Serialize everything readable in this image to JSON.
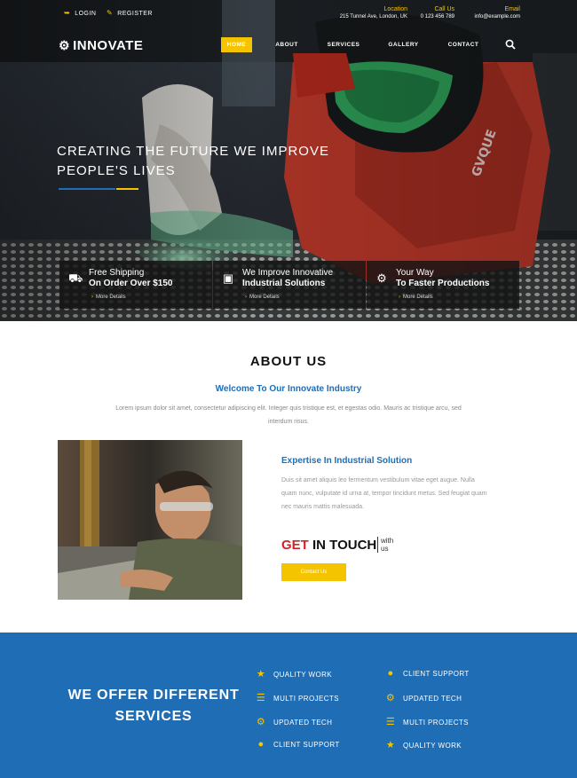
{
  "topbar": {
    "login": "LOGIN",
    "register": "REGISTER",
    "location_label": "Location",
    "location_value": "215 Tunnel Ave, London, UK",
    "call_label": "Call Us",
    "call_value": "0 123 456 789",
    "email_label": "Email",
    "email_value": "info@example.com"
  },
  "nav": {
    "logo": "INNOVATE",
    "items": [
      "HOME",
      "ABOUT",
      "SERVICES",
      "GALLERY",
      "CONTACT"
    ]
  },
  "hero": {
    "title_line1": "CREATING THE FUTURE WE IMPROVE",
    "title_line2": "PEOPLE'S LIVES"
  },
  "features": [
    {
      "line1": "Free Shipping",
      "line2": "On Order Over $150",
      "more": "More Details",
      "icon": "truck-icon"
    },
    {
      "line1": "We Improve Innovative",
      "line2": "Industrial Solutions",
      "more": "More Details",
      "icon": "factory-icon"
    },
    {
      "line1": "Your Way",
      "line2": "To Faster Productions",
      "more": "More Details",
      "icon": "gears-icon"
    }
  ],
  "about": {
    "title": "ABOUT US",
    "subtitle": "Welcome To Our Innovate Industry",
    "text": "Lorem ipsum dolor sit amet, consectetur adipiscing elit. Integer quis tristique est, et egestas odio. Mauris ac tristique arcu, sed interdum risus.",
    "expertise_title": "Expertise In Industrial Solution",
    "expertise_text": "Duis sit amet aliquis leo fermentum vestibulum vitae eget augue. Nulla quam nunc, vulputate id urna at, tempor tincidunt metus. Sed feugiat quam nec mauris mattis malesuada.",
    "get": "GET",
    "in_touch": " IN TOUCH",
    "with": "with",
    "us": "us",
    "button": "Contact Us"
  },
  "services": {
    "title_line1": "WE OFFER DIFFERENT",
    "title_line2": "SERVICES",
    "items": [
      {
        "label": "QUALITY WORK",
        "icon": "star-icon"
      },
      {
        "label": "CLIENT SUPPORT",
        "icon": "users-icon"
      },
      {
        "label": "MULTI PROJECTS",
        "icon": "server-icon"
      },
      {
        "label": "UPDATED TECH",
        "icon": "cogs-icon"
      },
      {
        "label": "UPDATED TECH",
        "icon": "cogs-icon"
      },
      {
        "label": "MULTI PROJECTS",
        "icon": "server-icon"
      },
      {
        "label": "CLIENT SUPPORT",
        "icon": "users-icon"
      },
      {
        "label": "QUALITY WORK",
        "icon": "star-icon"
      }
    ]
  },
  "colors": {
    "accent_yellow": "#f5c400",
    "brand_blue": "#1f6db5",
    "get_red": "#d0232a"
  }
}
